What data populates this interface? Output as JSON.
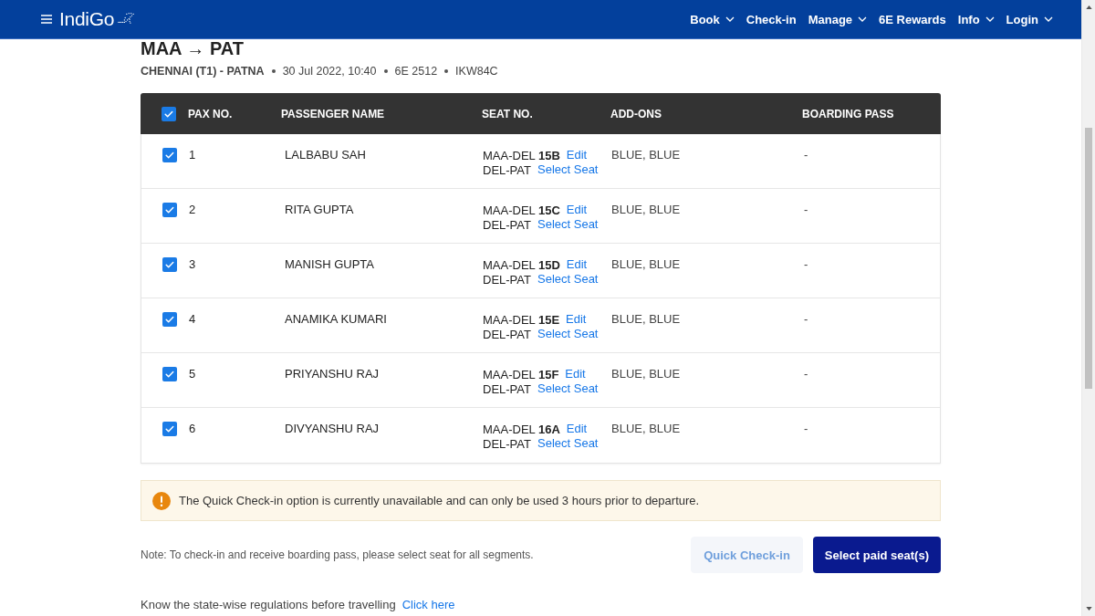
{
  "header": {
    "logo": "IndiGo",
    "nav": [
      {
        "label": "Book",
        "dropdown": true
      },
      {
        "label": "Check-in",
        "dropdown": false
      },
      {
        "label": "Manage",
        "dropdown": true
      },
      {
        "label": "6E Rewards",
        "dropdown": false
      },
      {
        "label": "Info",
        "dropdown": true
      },
      {
        "label": "Login",
        "dropdown": true
      }
    ]
  },
  "flight": {
    "title": "MAA → PAT",
    "details": [
      "CHENNAI (T1) - PATNA",
      "30 Jul 2022, 10:40",
      "6E 2512",
      "IKW84C"
    ]
  },
  "table": {
    "select_all": {
      "checked": true
    },
    "columns": [
      "PAX NO.",
      "PASSENGER NAME",
      "SEAT NO.",
      "ADD-ONS",
      "BOARDING PASS"
    ],
    "rows": [
      {
        "checked": true,
        "pax_no": "1",
        "name": "LALBABU SAH",
        "segments": [
          {
            "route": "MAA-DEL **15B**",
            "action": "Edit"
          },
          {
            "route": "DEL-PAT",
            "action": "Select Seat"
          }
        ],
        "add_ons": "BLUE, BLUE",
        "boarding_pass": "-"
      },
      {
        "checked": true,
        "pax_no": "2",
        "name": "RITA GUPTA",
        "segments": [
          {
            "route": "MAA-DEL **15C**",
            "action": "Edit"
          },
          {
            "route": "DEL-PAT",
            "action": "Select Seat"
          }
        ],
        "add_ons": "BLUE, BLUE",
        "boarding_pass": "-"
      },
      {
        "checked": true,
        "pax_no": "3",
        "name": "MANISH GUPTA",
        "segments": [
          {
            "route": "MAA-DEL **15D**",
            "action": "Edit"
          },
          {
            "route": "DEL-PAT",
            "action": "Select Seat"
          }
        ],
        "add_ons": "BLUE, BLUE",
        "boarding_pass": "-"
      },
      {
        "checked": true,
        "pax_no": "4",
        "name": "ANAMIKA KUMARI",
        "segments": [
          {
            "route": "MAA-DEL **15E**",
            "action": "Edit"
          },
          {
            "route": "DEL-PAT",
            "action": "Select Seat"
          }
        ],
        "add_ons": "BLUE, BLUE",
        "boarding_pass": "-"
      },
      {
        "checked": true,
        "pax_no": "5",
        "name": "PRIYANSHU RAJ",
        "segments": [
          {
            "route": "MAA-DEL **15F**",
            "action": "Edit"
          },
          {
            "route": "DEL-PAT",
            "action": "Select Seat"
          }
        ],
        "add_ons": "BLUE, BLUE",
        "boarding_pass": "-"
      },
      {
        "checked": true,
        "pax_no": "6",
        "name": "DIVYANSHU RAJ",
        "segments": [
          {
            "route": "MAA-DEL **16A**",
            "action": "Edit"
          },
          {
            "route": "DEL-PAT",
            "action": "Select Seat"
          }
        ],
        "add_ons": "BLUE, BLUE",
        "boarding_pass": "-"
      }
    ]
  },
  "alert": {
    "text": "The Quick Check-in option is currently unavailable and can only be used 3 hours prior to departure."
  },
  "note": "Note: To check-in and receive boarding pass, please select seat for all segments.",
  "buttons": [
    {
      "label": "Quick Check-in",
      "kind": "secondary",
      "disabled": true
    },
    {
      "label": "Select paid seat(s)",
      "kind": "primary",
      "disabled": false
    }
  ],
  "regulations": {
    "text": "Know the state-wise regulations before travelling",
    "link": "Click here"
  }
}
